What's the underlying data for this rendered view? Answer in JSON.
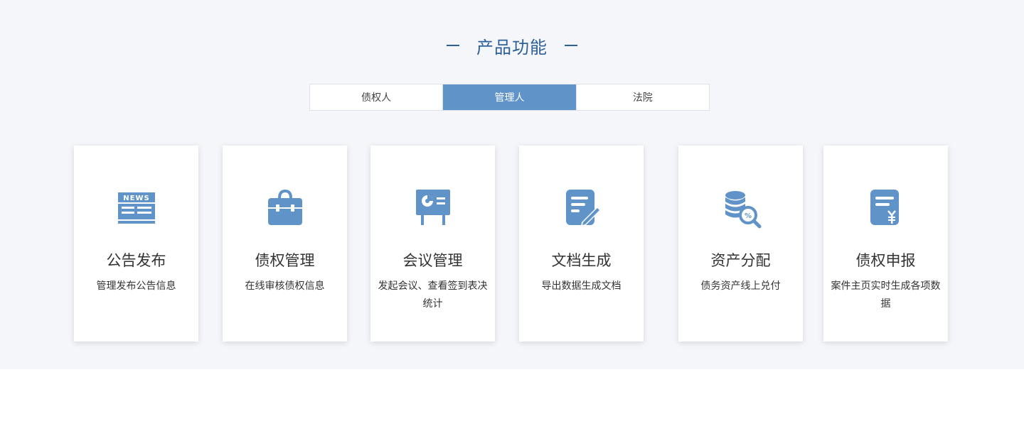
{
  "section": {
    "title": "产品功能"
  },
  "tabs": [
    {
      "label": "债权人",
      "active": false
    },
    {
      "label": "管理人",
      "active": true
    },
    {
      "label": "法院",
      "active": false
    }
  ],
  "cards": [
    {
      "title": "公告发布",
      "desc": "管理发布公告信息",
      "icon": "news-icon"
    },
    {
      "title": "债权管理",
      "desc": "在线审核债权信息",
      "icon": "briefcase-icon"
    },
    {
      "title": "会议管理",
      "desc": "发起会议、查看签到表决统计",
      "icon": "presentation-board-icon"
    },
    {
      "title": "文档生成",
      "desc": "导出数据生成文档",
      "icon": "document-edit-icon"
    },
    {
      "title": "资产分配",
      "desc": "债务资产线上兑付",
      "icon": "coins-search-icon"
    },
    {
      "title": "债权申报",
      "desc": "案件主页实时生成各项数据",
      "icon": "yuan-document-icon"
    }
  ],
  "colors": {
    "accent": "#6094c9",
    "title": "#2d5f98",
    "background": "#f4f6fa"
  }
}
